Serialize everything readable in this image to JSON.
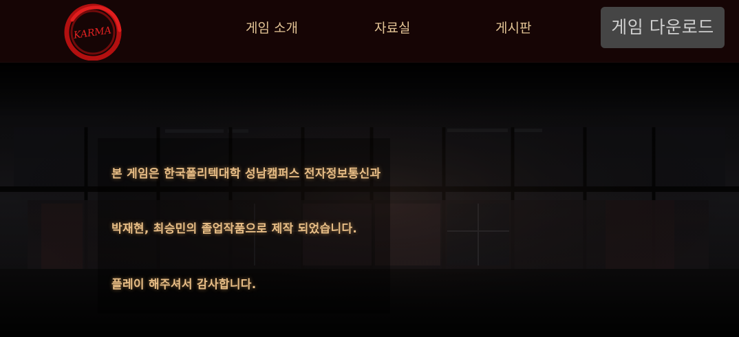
{
  "header": {
    "logo_text": "KARMA",
    "nav": [
      {
        "label": "게임 소개"
      },
      {
        "label": "자료실"
      },
      {
        "label": "게시판"
      }
    ],
    "download_label": "게임 다운로드"
  },
  "main": {
    "lines": [
      "본 게임은 한국폴리텍대학 성남캠퍼스 전자정보통신과",
      "박재현, 최승민의 졸업작품으로 제작 되었습니다.",
      "플레이 해주셔서 감사합니다."
    ]
  },
  "colors": {
    "header_bg": "#160505",
    "nav_text": "#e4c596",
    "body_text": "#e7bd86",
    "button_bg": "#454545",
    "logo_red": "#d01818"
  }
}
